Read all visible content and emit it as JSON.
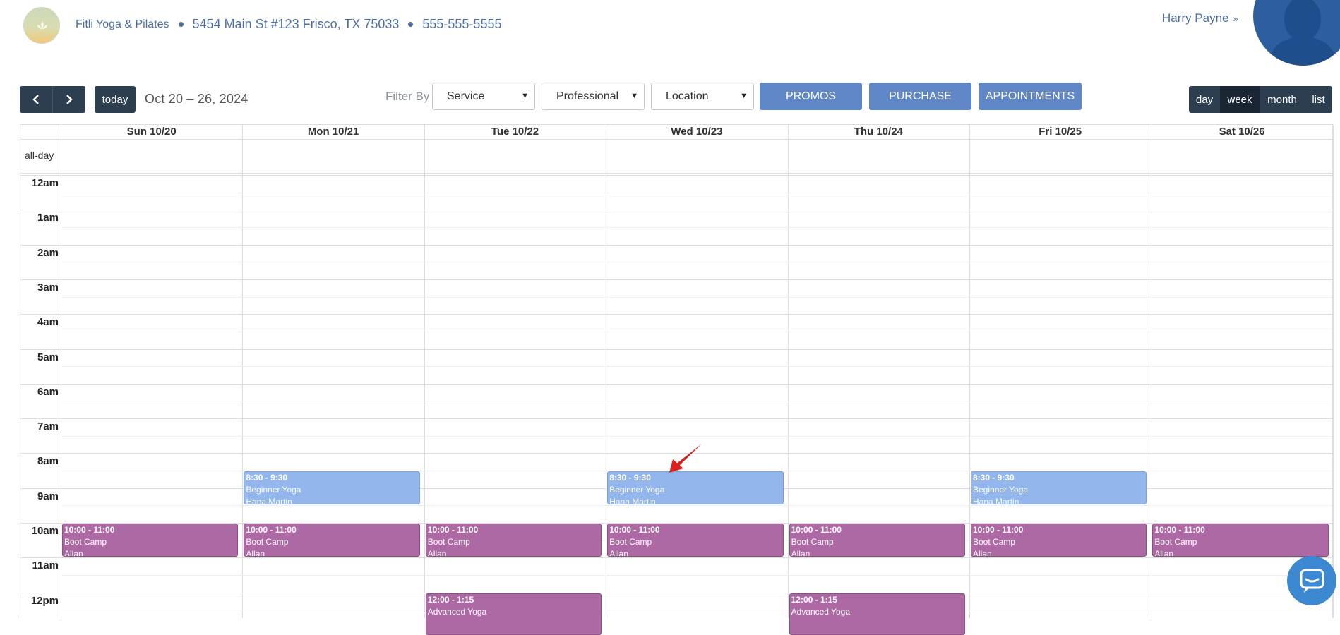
{
  "header": {
    "business_name": "Fitli Yoga & Pilates",
    "address": "5454 Main St #123 Frisco, TX 75033",
    "phone": "555-555-5555",
    "user_name": "Harry Payne",
    "user_chevron": "»"
  },
  "toolbar": {
    "prev_icon": "chevron-left",
    "next_icon": "chevron-right",
    "today_label": "today",
    "date_range": "Oct 20 – 26, 2024",
    "filter_by_label": "Filter By",
    "filters": [
      "Service",
      "Professional",
      "Location"
    ],
    "actions": [
      "PROMOS",
      "PURCHASE",
      "APPOINTMENTS"
    ],
    "views": [
      "day",
      "week",
      "month",
      "list"
    ],
    "active_view": "week"
  },
  "calendar": {
    "days": [
      "Sun 10/20",
      "Mon 10/21",
      "Tue 10/22",
      "Wed 10/23",
      "Thu 10/24",
      "Fri 10/25",
      "Sat 10/26"
    ],
    "allday_label": "all-day",
    "hours": [
      "12am",
      "1am",
      "2am",
      "3am",
      "4am",
      "5am",
      "6am",
      "7am",
      "8am",
      "9am",
      "10am",
      "11am",
      "12pm"
    ],
    "events": [
      {
        "day": 1,
        "start": 8.5,
        "end": 9.5,
        "time": "8:30 - 9:30",
        "title": "Beginner Yoga",
        "who": "Hana Martin",
        "color": "#93b6ec"
      },
      {
        "day": 3,
        "start": 8.5,
        "end": 9.5,
        "time": "8:30 - 9:30",
        "title": "Beginner Yoga",
        "who": "Hana Martin",
        "color": "#93b6ec"
      },
      {
        "day": 5,
        "start": 8.5,
        "end": 9.5,
        "time": "8:30 - 9:30",
        "title": "Beginner Yoga",
        "who": "Hana Martin",
        "color": "#93b6ec"
      },
      {
        "day": 0,
        "start": 10,
        "end": 11,
        "time": "10:00 - 11:00",
        "title": "Boot Camp",
        "who": "Allan",
        "color": "#ad69a3"
      },
      {
        "day": 1,
        "start": 10,
        "end": 11,
        "time": "10:00 - 11:00",
        "title": "Boot Camp",
        "who": "Allan",
        "color": "#ad69a3"
      },
      {
        "day": 2,
        "start": 10,
        "end": 11,
        "time": "10:00 - 11:00",
        "title": "Boot Camp",
        "who": "Allan",
        "color": "#ad69a3"
      },
      {
        "day": 3,
        "start": 10,
        "end": 11,
        "time": "10:00 - 11:00",
        "title": "Boot Camp",
        "who": "Allan",
        "color": "#ad69a3"
      },
      {
        "day": 4,
        "start": 10,
        "end": 11,
        "time": "10:00 - 11:00",
        "title": "Boot Camp",
        "who": "Allan",
        "color": "#ad69a3"
      },
      {
        "day": 5,
        "start": 10,
        "end": 11,
        "time": "10:00 - 11:00",
        "title": "Boot Camp",
        "who": "Allan",
        "color": "#ad69a3"
      },
      {
        "day": 6,
        "start": 10,
        "end": 11,
        "time": "10:00 - 11:00",
        "title": "Boot Camp",
        "who": "Allan",
        "color": "#ad69a3"
      },
      {
        "day": 2,
        "start": 12,
        "end": 13.25,
        "time": "12:00 - 1:15",
        "title": "Advanced Yoga",
        "who": "",
        "color": "#ad69a3"
      },
      {
        "day": 4,
        "start": 12,
        "end": 13.25,
        "time": "12:00 - 1:15",
        "title": "Advanced Yoga",
        "who": "",
        "color": "#ad69a3"
      }
    ]
  },
  "icons": {
    "chat": "chat-bubble-icon",
    "annotation": "red-arrow-icon"
  }
}
